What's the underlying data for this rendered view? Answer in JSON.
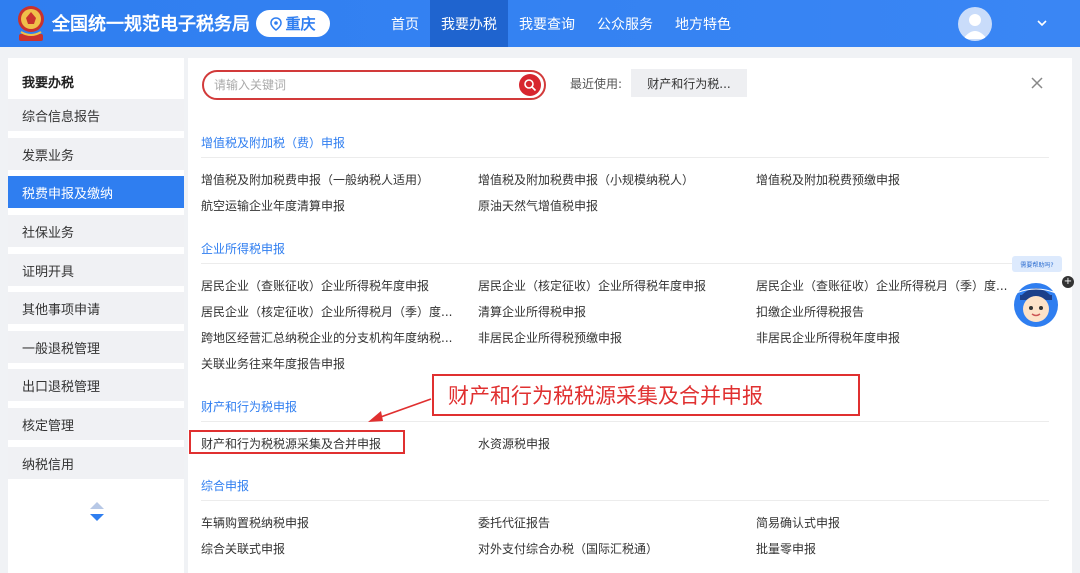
{
  "header": {
    "site_title": "全国统一规范电子税务局",
    "region": "重庆",
    "nav": [
      "首页",
      "我要办税",
      "我要查询",
      "公众服务",
      "地方特色"
    ],
    "active_nav": "我要办税"
  },
  "sidebar": {
    "title": "我要办税",
    "items": [
      "综合信息报告",
      "发票业务",
      "税费申报及缴纳",
      "社保业务",
      "证明开具",
      "其他事项申请",
      "一般退税管理",
      "出口退税管理",
      "核定管理",
      "纳税信用"
    ],
    "active_item": "税费申报及缴纳"
  },
  "search": {
    "placeholder": "请输入关键词",
    "value": ""
  },
  "recent": {
    "label": "最近使用:",
    "tag": "财产和行为税..."
  },
  "sections": [
    {
      "title": "增值税及附加税（费）申报",
      "rows": [
        [
          "增值税及附加税费申报（一般纳税人适用）",
          "增值税及附加税费申报（小规模纳税人）",
          "增值税及附加税费预缴申报"
        ],
        [
          "航空运输企业年度清算申报",
          "原油天然气增值税申报",
          ""
        ]
      ]
    },
    {
      "title": "企业所得税申报",
      "rows": [
        [
          "居民企业（查账征收）企业所得税年度申报",
          "居民企业（核定征收）企业所得税年度申报",
          "居民企业（查账征收）企业所得税月（季）度..."
        ],
        [
          "居民企业（核定征收）企业所得税月（季）度...",
          "清算企业所得税申报",
          "扣缴企业所得税报告"
        ],
        [
          "跨地区经营汇总纳税企业的分支机构年度纳税...",
          "非居民企业所得税预缴申报",
          "非居民企业所得税年度申报"
        ],
        [
          "关联业务往来年度报告申报",
          "",
          ""
        ]
      ]
    },
    {
      "title": "财产和行为税申报",
      "rows": [
        [
          "财产和行为税税源采集及合并申报",
          "水资源税申报",
          ""
        ]
      ]
    },
    {
      "title": "综合申报",
      "rows": [
        [
          "车辆购置税纳税申报",
          "委托代征报告",
          "简易确认式申报"
        ],
        [
          "综合关联式申报",
          "对外支付综合办税（国际汇税通）",
          "批量零申报"
        ]
      ]
    }
  ],
  "annotation": {
    "callout_text": "财产和行为税税源采集及合并申报"
  },
  "helper": {
    "bubble_text": "需要帮助吗?",
    "plus": "+"
  },
  "colors": {
    "header_blue": "#2f7ef0",
    "active_nav": "#1f64cf",
    "section_title": "#2f7ef0",
    "highlight_red": "#e03030"
  }
}
